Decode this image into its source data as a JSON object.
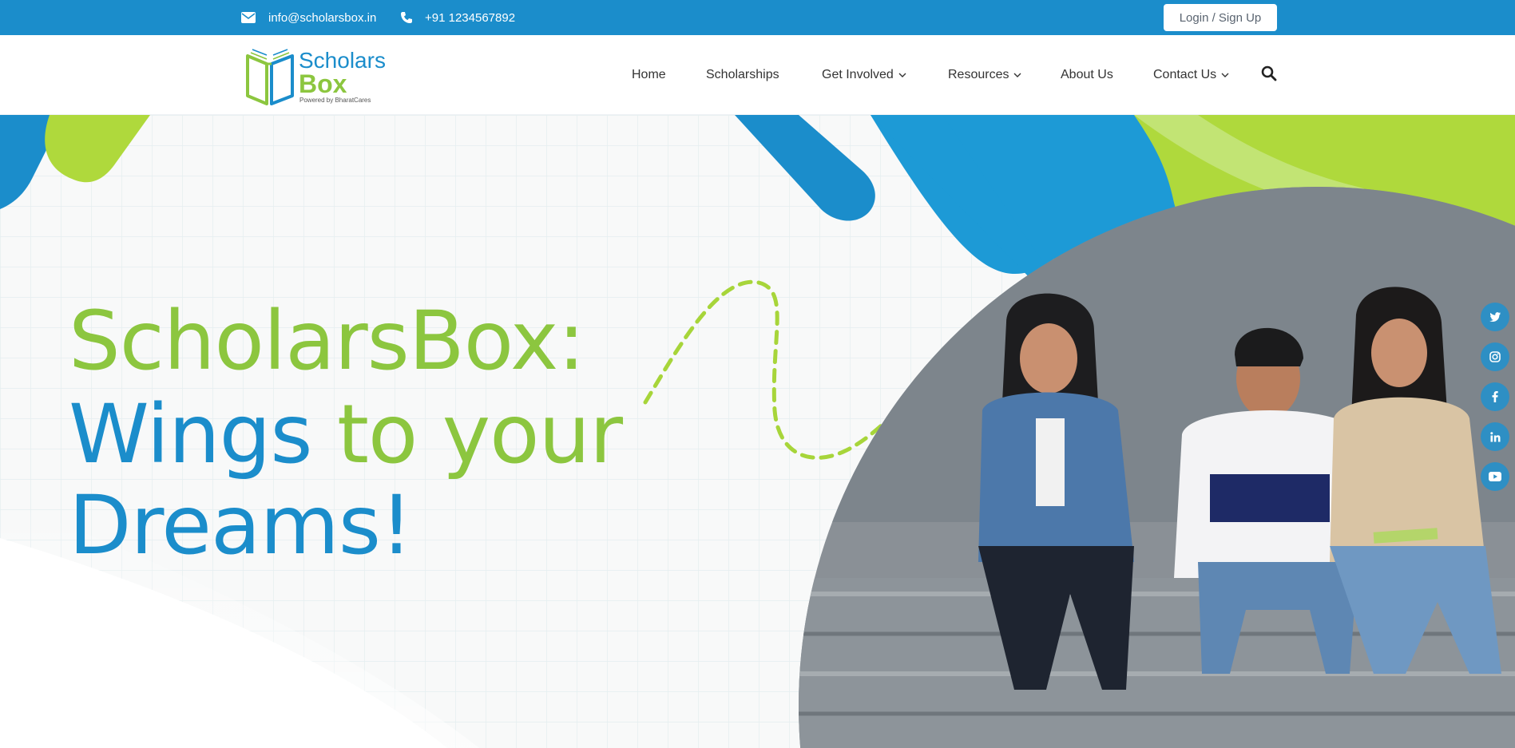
{
  "topbar": {
    "email": "info@scholarsbox.in",
    "phone": "+91 1234567892",
    "login_label": "Login / Sign Up"
  },
  "logo": {
    "word1": "Scholars",
    "word2": "Box",
    "tagline": "Powered by BharatCares"
  },
  "nav": {
    "items": [
      {
        "label": "Home",
        "dropdown": false
      },
      {
        "label": "Scholarships",
        "dropdown": false
      },
      {
        "label": "Get Involved",
        "dropdown": true
      },
      {
        "label": "Resources",
        "dropdown": true
      },
      {
        "label": "About Us",
        "dropdown": false
      },
      {
        "label": "Contact Us",
        "dropdown": true
      }
    ],
    "search_icon": "search-icon"
  },
  "hero": {
    "line1": "ScholarsBox:",
    "line2_blue": "Wings",
    "line2_green": "to your",
    "line3": "Dreams!"
  },
  "social": [
    "twitter-icon",
    "instagram-icon",
    "facebook-icon",
    "linkedin-icon",
    "youtube-icon"
  ],
  "colors": {
    "brand_blue": "#1b8dcb",
    "brand_green": "#8cc63f",
    "lime": "#afd93c"
  }
}
